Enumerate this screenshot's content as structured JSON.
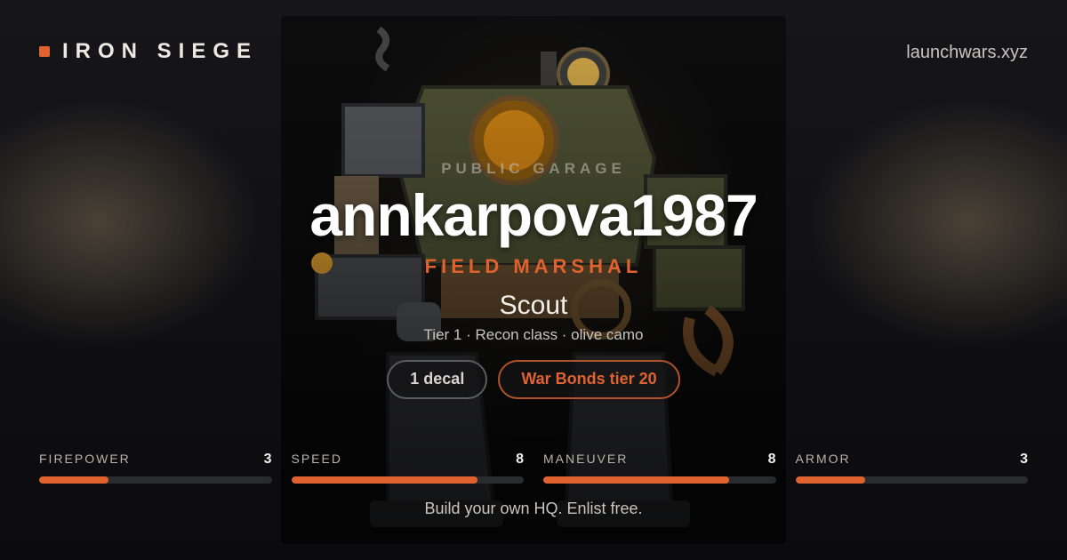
{
  "brand": {
    "name": "IRON SIEGE",
    "accent": "#e0622f"
  },
  "site": {
    "domain": "launchwars.xyz"
  },
  "profile": {
    "kicker": "PUBLIC GARAGE",
    "username": "annkarpova1987",
    "rank": "FIELD MARSHAL"
  },
  "mech": {
    "name": "Scout",
    "subtitle": "Tier 1 · Recon class · olive camo",
    "image_icon": "steampunk-mech-illustration"
  },
  "badges": [
    {
      "label": "1 decal",
      "style": "neutral"
    },
    {
      "label": "War Bonds tier 20",
      "style": "accent"
    }
  ],
  "stats": [
    {
      "label": "FIREPOWER",
      "value": "3",
      "fill": 0.3
    },
    {
      "label": "SPEED",
      "value": "8",
      "fill": 0.8
    },
    {
      "label": "MANEUVER",
      "value": "8",
      "fill": 0.8
    },
    {
      "label": "ARMOR",
      "value": "3",
      "fill": 0.3
    }
  ],
  "cta": {
    "text": "Build your own HQ. Enlist free."
  }
}
